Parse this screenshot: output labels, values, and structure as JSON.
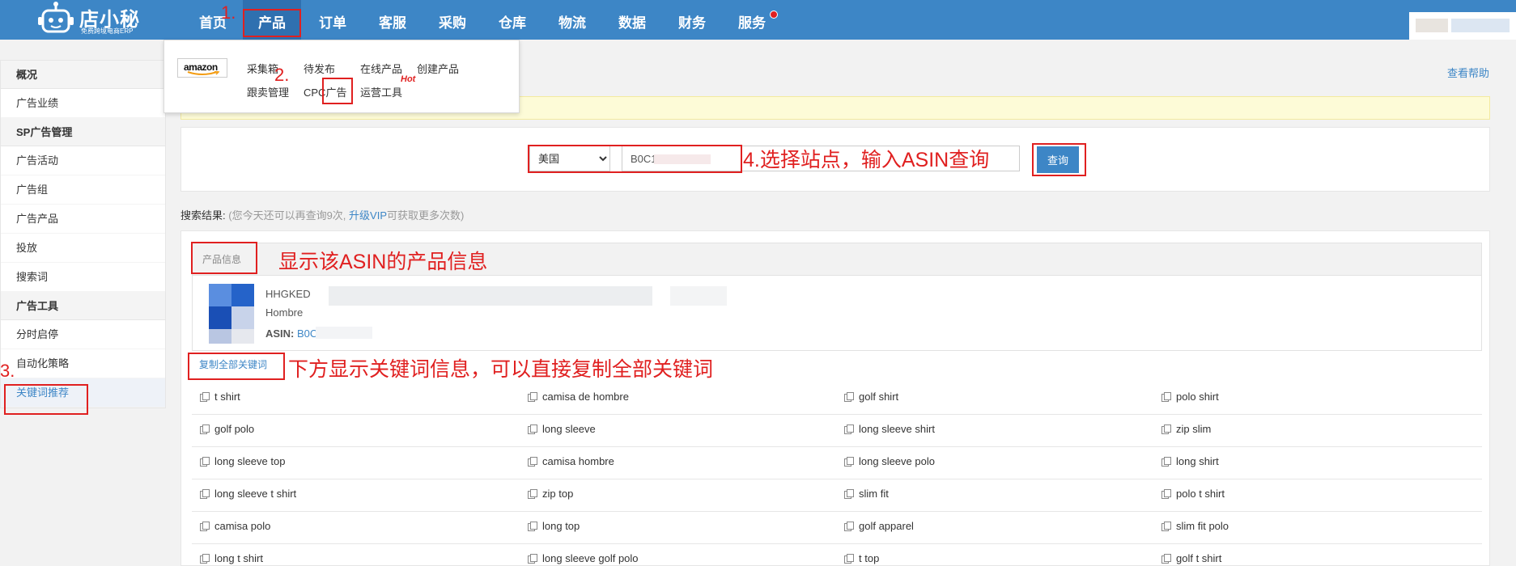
{
  "brand": {
    "name": "店小秘",
    "tagline": "免费跨境电商ERP"
  },
  "nav": {
    "items": [
      "首页",
      "产品",
      "订单",
      "客服",
      "采购",
      "仓库",
      "物流",
      "数据",
      "财务",
      "服务"
    ]
  },
  "dropdown": {
    "platform": "amazon",
    "row1": [
      "采集箱",
      "待发布",
      "在线产品",
      "创建产品"
    ],
    "row2": [
      "跟卖管理",
      "CPC广告",
      "运营工具"
    ],
    "hot_badge": "Hot"
  },
  "sidebar": {
    "sections": [
      {
        "title": "概况",
        "items": [
          "广告业绩"
        ]
      },
      {
        "title": "SP广告管理",
        "items": [
          "广告活动",
          "广告组",
          "广告产品",
          "投放",
          "搜索词"
        ]
      },
      {
        "title": "广告工具",
        "items": [
          "分时启停",
          "自动化策略",
          "关键词推荐"
        ]
      }
    ],
    "active_item": "关键词推荐"
  },
  "help_link": "查看帮助",
  "search": {
    "site_value": "美国",
    "asin_value": "B0C1",
    "query_button": "查询"
  },
  "result_line": {
    "label": "搜索结果:",
    "note_before": "(您今天还可以再查询9次, ",
    "upgrade": "升级VIP",
    "note_after": "可获取更多次数)"
  },
  "product": {
    "header": "产品信息",
    "name": "HHGKED",
    "subtitle": "Hombre",
    "asin_label": "ASIN:",
    "asin_value": "B0C1"
  },
  "copy_all_button": "复制全部关键词",
  "keywords": [
    [
      "t shirt",
      "camisa de hombre",
      "golf shirt",
      "polo shirt"
    ],
    [
      "golf polo",
      "long sleeve",
      "long sleeve shirt",
      "zip slim"
    ],
    [
      "long sleeve top",
      "camisa hombre",
      "long sleeve polo",
      "long shirt"
    ],
    [
      "long sleeve t shirt",
      "zip top",
      "slim fit",
      "polo t shirt"
    ],
    [
      "camisa polo",
      "long top",
      "golf apparel",
      "slim fit polo"
    ],
    [
      "long t shirt",
      "long sleeve golf polo",
      "t top",
      "golf t shirt"
    ]
  ],
  "annotations": {
    "step1": "1.",
    "step2": "2.",
    "step3": "3.",
    "step4": "4.选择站点，输入ASIN查询",
    "product_note": "显示该ASIN的产品信息",
    "keyword_note": "下方显示关键词信息，可以直接复制全部关键词"
  },
  "colors": {
    "nav_bg": "#3d86c6",
    "accent": "#3d86c6",
    "annotation": "#e02020",
    "notice_bg": "#fdfbd7"
  }
}
